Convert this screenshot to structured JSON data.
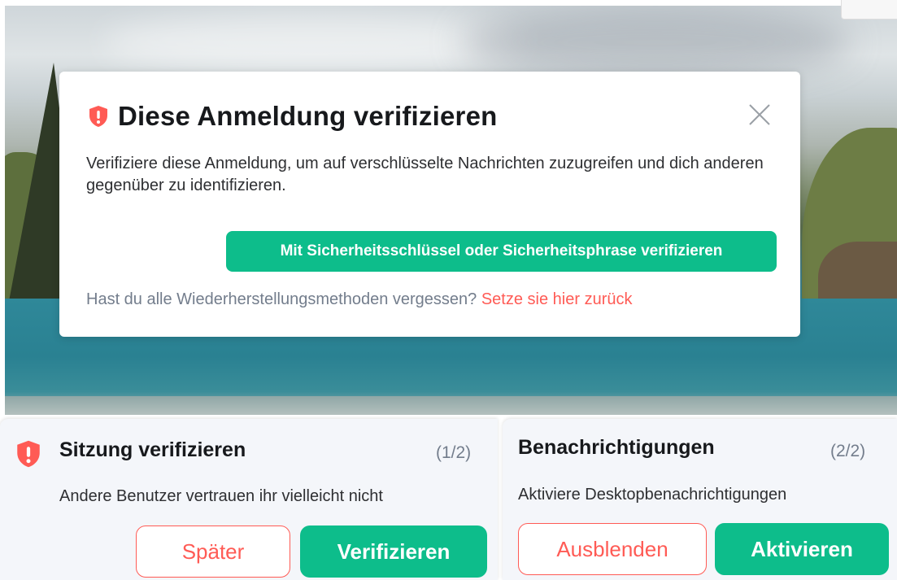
{
  "dialog": {
    "title": "Diese Anmeldung verifizieren",
    "description": "Verifiziere diese Anmeldung, um auf verschlüsselte Nachrichten zuzugreifen und dich anderen gegenüber zu identifizieren.",
    "primary_button": "Mit Sicherheitsschlüssel oder Sicherheitsphrase verifizieren",
    "reset_prompt": "Hast du alle Wiederherstellungsmethoden vergessen?",
    "reset_link": "Setze sie hier zurück",
    "icon": "shield-warning-icon",
    "close_icon": "close-icon"
  },
  "toasts": [
    {
      "title": "Sitzung verifizieren",
      "count": "(1/2)",
      "body": "Andere Benutzer vertrauen ihr vielleicht nicht",
      "secondary_button": "Später",
      "primary_button": "Verifizieren",
      "icon": "shield-warning-icon"
    },
    {
      "title": "Benachrichtigungen",
      "count": "(2/2)",
      "body": "Aktiviere Desktopbenachrichtigungen",
      "secondary_button": "Ausblenden",
      "primary_button": "Aktivieren"
    }
  ],
  "colors": {
    "accent": "#0dbd8b",
    "alert": "#ff5b55",
    "text_primary": "#17191c",
    "text_secondary": "#737d8c"
  }
}
